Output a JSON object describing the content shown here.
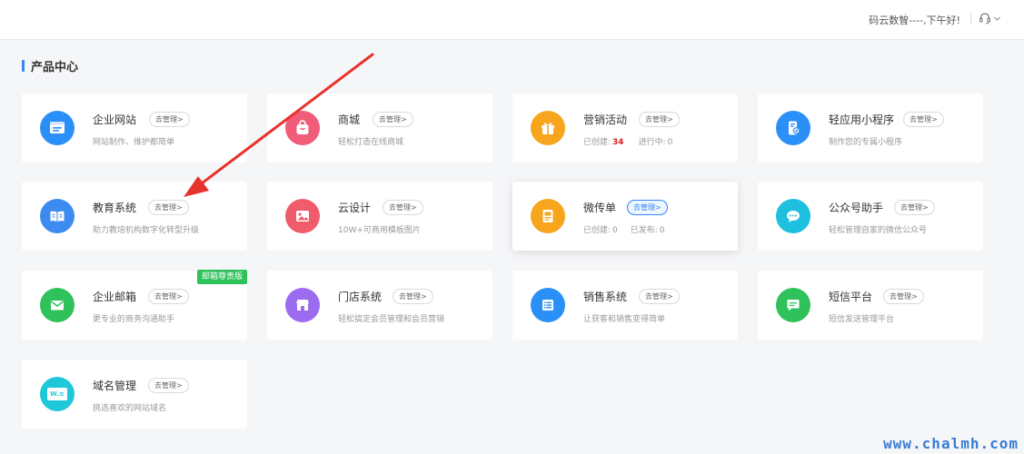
{
  "header": {
    "greeting": "码云数智----,下午好!"
  },
  "section": {
    "title": "产品中心"
  },
  "cards": [
    {
      "name": "企业网站",
      "manage_label": "去管理>",
      "desc": "网站制作、维护都简单",
      "icon": "website-icon",
      "color": "#2a8ff7"
    },
    {
      "name": "商城",
      "manage_label": "去管理>",
      "desc": "轻松打造在线商城",
      "icon": "shopping-bag-icon",
      "color": "#f15c78"
    },
    {
      "name": "营销活动",
      "manage_label": "去管理>",
      "desc_parts": {
        "created_label": "已创建:",
        "created_value": "34",
        "running_label": "进行中:",
        "running_value": "0"
      },
      "icon": "gift-icon",
      "color": "#f7a51c"
    },
    {
      "name": "轻应用小程序",
      "manage_label": "去管理>",
      "desc": "制作您的专属小程序",
      "icon": "mini-program-icon",
      "color": "#2a8ff7"
    },
    {
      "name": "教育系统",
      "manage_label": "去管理>",
      "desc": "助力教培机构数字化转型升级",
      "icon": "book-icon",
      "color": "#3c8bf1"
    },
    {
      "name": "云设计",
      "manage_label": "去管理>",
      "desc": "10W+可商用模板图片",
      "icon": "image-icon",
      "color": "#f15c6c"
    },
    {
      "name": "微传单",
      "manage_label": "去管理>",
      "desc_parts": {
        "created_label": "已创建:",
        "created_value": "0",
        "published_label": "已发布:",
        "published_value": "0"
      },
      "icon": "leaflet-icon",
      "color": "#f7a51c"
    },
    {
      "name": "公众号助手",
      "manage_label": "去管理>",
      "desc": "轻松管理自家的微信公众号",
      "icon": "wechat-icon",
      "color": "#1fbfe0"
    },
    {
      "name": "企业邮箱",
      "manage_label": "去管理>",
      "desc": "更专业的商务沟通助手",
      "icon": "mail-icon",
      "color": "#2fc25b",
      "badge": "邮箱尊贵版"
    },
    {
      "name": "门店系统",
      "manage_label": "去管理>",
      "desc": "轻松搞定会员管理和会员营销",
      "icon": "store-icon",
      "color": "#9b6cf0"
    },
    {
      "name": "销售系统",
      "manage_label": "去管理>",
      "desc": "让获客和销售变得简单",
      "icon": "list-icon",
      "color": "#2a8ff7"
    },
    {
      "name": "短信平台",
      "manage_label": "去管理>",
      "desc": "短信发送管理平台",
      "icon": "sms-icon",
      "color": "#2fc25b"
    },
    {
      "name": "域名管理",
      "manage_label": "去管理>",
      "desc": "挑选喜欢的网站域名",
      "icon": "domain-icon",
      "color": "#1fc8d8",
      "icon_text": "W.≡"
    }
  ],
  "watermark": "www.chalmh.com"
}
